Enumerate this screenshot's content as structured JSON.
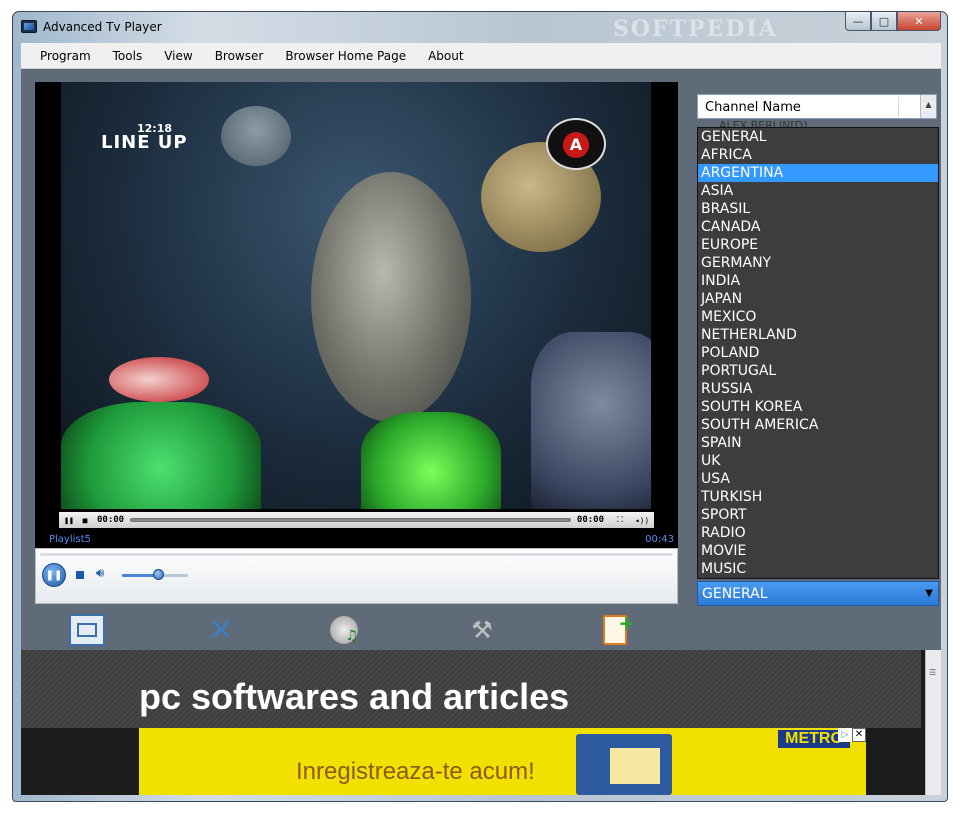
{
  "window": {
    "title": "Advanced Tv Player",
    "watermark": "SOFTPEDIA"
  },
  "caption_buttons": {
    "minimize": "—",
    "maximize": "□",
    "close": "✕"
  },
  "menu": {
    "items": [
      "Program",
      "Tools",
      "View",
      "Browser",
      "Browser Home Page",
      "About"
    ]
  },
  "video": {
    "overlay_time": "12:18",
    "overlay_brand": "LINE UP",
    "channel_logo_letter": "A",
    "seek_start_time": "00:00",
    "seek_end_time": "00:00",
    "playlist_label": "Playlist5",
    "playlist_time": "00:43"
  },
  "player": {
    "volume_fraction": 0.55
  },
  "channel_panel": {
    "header": "Channel Name",
    "peek_item": "ALEX BERLIN[D]",
    "categories": [
      "GENERAL",
      "AFRICA",
      "ARGENTINA",
      "ASIA",
      "BRASIL",
      "CANADA",
      "EUROPE",
      "GERMANY",
      "INDIA",
      "JAPAN",
      "MEXICO",
      "NETHERLAND",
      "POLAND",
      "PORTUGAL",
      "RUSSIA",
      "SOUTH KOREA",
      "SOUTH AMERICA",
      "SPAIN",
      "UK",
      "USA",
      "TURKISH",
      "SPORT",
      "RADIO",
      "MOVIE",
      "MUSIC"
    ],
    "highlighted_index": 2,
    "selected": "GENERAL"
  },
  "toolbar": {
    "icons": [
      "fullscreen-icon",
      "shuffle-icon",
      "music-disc-icon",
      "tools-icon",
      "add-channel-icon"
    ]
  },
  "browser": {
    "headline": "pc softwares and articles",
    "ad_text": "Inregistreaza-te acum!",
    "ad_brand": "METRO"
  },
  "colors": {
    "accent": "#3399ff",
    "panel_bg": "#5f6b78",
    "ad_bg": "#f2e000"
  }
}
